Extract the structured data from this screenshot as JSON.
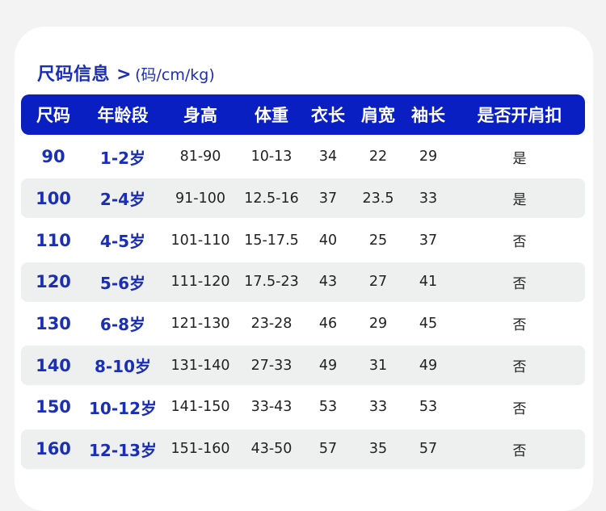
{
  "title": {
    "main": "尺码信息 >",
    "unit": "(码/cm/kg)"
  },
  "table": {
    "headers": [
      "尺码",
      "年龄段",
      "身高",
      "体重",
      "衣长",
      "肩宽",
      "袖长",
      "是否开肩扣"
    ],
    "rows": [
      [
        "90",
        "1-2岁",
        "81-90",
        "10-13",
        "34",
        "22",
        "29",
        "是"
      ],
      [
        "100",
        "2-4岁",
        "91-100",
        "12.5-16",
        "37",
        "23.5",
        "33",
        "是"
      ],
      [
        "110",
        "4-5岁",
        "101-110",
        "15-17.5",
        "40",
        "25",
        "37",
        "否"
      ],
      [
        "120",
        "5-6岁",
        "111-120",
        "17.5-23",
        "43",
        "27",
        "41",
        "否"
      ],
      [
        "130",
        "6-8岁",
        "121-130",
        "23-28",
        "46",
        "29",
        "45",
        "否"
      ],
      [
        "140",
        "8-10岁",
        "131-140",
        "27-33",
        "49",
        "31",
        "49",
        "否"
      ],
      [
        "150",
        "10-12岁",
        "141-150",
        "33-43",
        "53",
        "33",
        "53",
        "否"
      ],
      [
        "160",
        "12-13岁",
        "151-160",
        "43-50",
        "57",
        "35",
        "57",
        "否"
      ]
    ]
  },
  "colors": {
    "accent": "#0a1fc2",
    "title": "#1a2fb4",
    "stripe": "#eef0f0",
    "background": "#f3f3f3"
  }
}
